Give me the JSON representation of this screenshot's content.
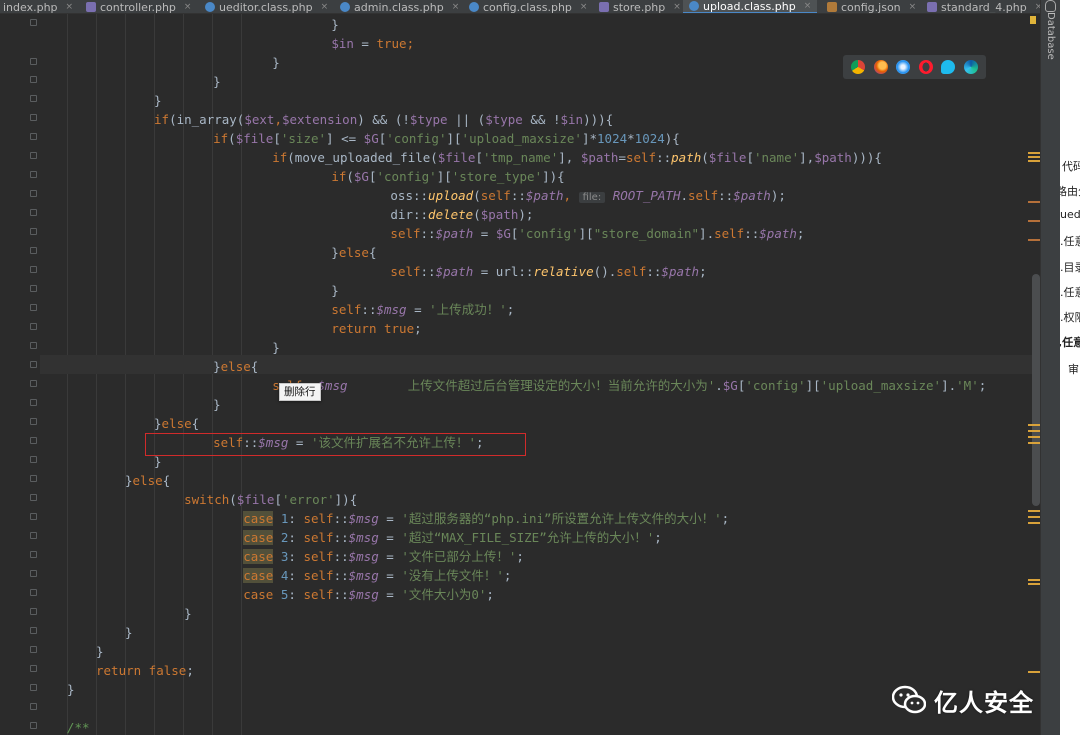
{
  "tabs": [
    {
      "label": "index.php",
      "icon": "php-file-icon"
    },
    {
      "label": "controller.php",
      "icon": "php-file-icon"
    },
    {
      "label": "ueditor.class.php",
      "icon": "php-class-icon"
    },
    {
      "label": "admin.class.php",
      "icon": "php-class-icon"
    },
    {
      "label": "config.class.php",
      "icon": "php-class-icon"
    },
    {
      "label": "store.php",
      "icon": "php-file-icon"
    },
    {
      "label": "upload.class.php",
      "icon": "php-class-icon",
      "active": true
    },
    {
      "label": "config.json",
      "icon": "json-file-icon"
    },
    {
      "label": "standard_4.php",
      "icon": "php-file-icon"
    }
  ],
  "code": [
    [
      [
        "            }",
        ""
      ]
    ],
    [
      [
        "            ",
        ""
      ],
      [
        "$in",
        "var"
      ],
      [
        " = ",
        ""
      ],
      [
        "true",
        "kw"
      ],
      [
        ";",
        "kw"
      ]
    ],
    [
      [
        "        }",
        ""
      ]
    ],
    [
      [
        "    }",
        ""
      ]
    ],
    [
      [
        "}",
        ""
      ]
    ],
    [
      [
        "if",
        "kw"
      ],
      [
        "(in_array(",
        ""
      ],
      [
        "$ext",
        "var"
      ],
      [
        ",",
        "kw"
      ],
      [
        "$extension",
        "var"
      ],
      [
        ") && (!",
        ""
      ],
      [
        "$type",
        "var"
      ],
      [
        " || (",
        ""
      ],
      [
        "$type",
        "var"
      ],
      [
        " && !",
        ""
      ],
      [
        "$in",
        "var"
      ],
      [
        "))){",
        ""
      ]
    ],
    [
      [
        "    ",
        ""
      ],
      [
        "if",
        "kw"
      ],
      [
        "(",
        ""
      ],
      [
        "$file",
        "var"
      ],
      [
        "[",
        ""
      ],
      [
        "'size'",
        "str"
      ],
      [
        "] <= ",
        ""
      ],
      [
        "$G",
        "var"
      ],
      [
        "[",
        ""
      ],
      [
        "'config'",
        "str"
      ],
      [
        "][",
        ""
      ],
      [
        "'upload_maxsize'",
        "str"
      ],
      [
        "]*",
        ""
      ],
      [
        "1024",
        "num"
      ],
      [
        "*",
        ""
      ],
      [
        "1024",
        "num"
      ],
      [
        "){",
        ""
      ]
    ],
    [
      [
        "        ",
        ""
      ],
      [
        "if",
        "kw"
      ],
      [
        "(move_uploaded_file(",
        ""
      ],
      [
        "$file",
        "var"
      ],
      [
        "[",
        ""
      ],
      [
        "'tmp_name'",
        "str"
      ],
      [
        "], ",
        ""
      ],
      [
        "$path",
        "var"
      ],
      [
        "=",
        ""
      ],
      [
        "self",
        "kw"
      ],
      [
        "::",
        ""
      ],
      [
        "path",
        "fn"
      ],
      [
        "(",
        ""
      ],
      [
        "$file",
        "var"
      ],
      [
        "[",
        ""
      ],
      [
        "'name'",
        "str"
      ],
      [
        "],",
        ""
      ],
      [
        "$path",
        "var"
      ],
      [
        "))){",
        ""
      ]
    ],
    [
      [
        "            ",
        ""
      ],
      [
        "if",
        "kw"
      ],
      [
        "(",
        ""
      ],
      [
        "$G",
        "var"
      ],
      [
        "[",
        ""
      ],
      [
        "'config'",
        "str"
      ],
      [
        "][",
        ""
      ],
      [
        "'store_type'",
        "str"
      ],
      [
        "]){",
        ""
      ]
    ],
    [
      [
        "                oss::",
        ""
      ],
      [
        "upload",
        "fn"
      ],
      [
        "(",
        ""
      ],
      [
        "self",
        "kw"
      ],
      [
        "::",
        ""
      ],
      [
        "$path",
        "ivar"
      ],
      [
        ", ",
        "kw"
      ],
      [
        "file:",
        "hint"
      ],
      [
        " ",
        ""
      ],
      [
        "ROOT_PATH",
        "ivar"
      ],
      [
        ".",
        ""
      ],
      [
        "self",
        "kw"
      ],
      [
        "::",
        ""
      ],
      [
        "$path",
        "ivar"
      ],
      [
        ");",
        ""
      ]
    ],
    [
      [
        "                dir::",
        ""
      ],
      [
        "delete",
        "fn"
      ],
      [
        "(",
        ""
      ],
      [
        "$path",
        "var"
      ],
      [
        ");",
        ""
      ]
    ],
    [
      [
        "                ",
        ""
      ],
      [
        "self",
        "kw"
      ],
      [
        "::",
        ""
      ],
      [
        "$path",
        "ivar"
      ],
      [
        " = ",
        ""
      ],
      [
        "$G",
        "var"
      ],
      [
        "[",
        ""
      ],
      [
        "'config'",
        "str"
      ],
      [
        "][",
        ""
      ],
      [
        "\"store_domain\"",
        "str"
      ],
      [
        "].",
        ""
      ],
      [
        "self",
        "kw"
      ],
      [
        "::",
        ""
      ],
      [
        "$path",
        "ivar"
      ],
      [
        ";",
        ""
      ]
    ],
    [
      [
        "            }",
        ""
      ],
      [
        "else",
        "kw"
      ],
      [
        "{",
        ""
      ]
    ],
    [
      [
        "                ",
        ""
      ],
      [
        "self",
        "kw"
      ],
      [
        "::",
        ""
      ],
      [
        "$path",
        "ivar"
      ],
      [
        " = url::",
        ""
      ],
      [
        "relative",
        "fn"
      ],
      [
        "().",
        ""
      ],
      [
        "self",
        "kw"
      ],
      [
        "::",
        ""
      ],
      [
        "$path",
        "ivar"
      ],
      [
        ";",
        ""
      ]
    ],
    [
      [
        "            }",
        ""
      ]
    ],
    [
      [
        "            ",
        ""
      ],
      [
        "self",
        "kw"
      ],
      [
        "::",
        ""
      ],
      [
        "$msg",
        "ivar"
      ],
      [
        " = ",
        ""
      ],
      [
        "'上传成功！'",
        "str"
      ],
      [
        ";",
        ""
      ]
    ],
    [
      [
        "            ",
        ""
      ],
      [
        "return true",
        "kw"
      ],
      [
        ";",
        ""
      ]
    ],
    [
      [
        "        }",
        ""
      ]
    ],
    [
      [
        "    }",
        ""
      ],
      [
        "else",
        "kw"
      ],
      [
        "{",
        ""
      ]
    ],
    [
      [
        "        ",
        ""
      ],
      [
        "self",
        "kw"
      ],
      [
        "::",
        ""
      ],
      [
        "$msg",
        "ivar"
      ],
      [
        "        ",
        ""
      ],
      [
        "上传文件超过后台管理设定的大小！当前允许的大小为'",
        "str"
      ],
      [
        ".",
        ""
      ],
      [
        "$G",
        "var"
      ],
      [
        "[",
        ""
      ],
      [
        "'config'",
        "str"
      ],
      [
        "][",
        ""
      ],
      [
        "'upload_maxsize'",
        "str"
      ],
      [
        "].",
        ""
      ],
      [
        "'M'",
        "str"
      ],
      [
        ";",
        ""
      ]
    ],
    [
      [
        "    }",
        ""
      ]
    ],
    [
      [
        "}",
        ""
      ],
      [
        "else",
        "kw"
      ],
      [
        "{",
        ""
      ]
    ],
    [
      [
        "    ",
        ""
      ],
      [
        "self",
        "kw"
      ],
      [
        "::",
        ""
      ],
      [
        "$msg",
        "ivar"
      ],
      [
        " = ",
        ""
      ],
      [
        "'该文件扩展名不允许上传！'",
        "str"
      ],
      [
        ";",
        ""
      ]
    ],
    [
      [
        "}",
        ""
      ]
    ],
    [
      [
        "}",
        ""
      ],
      [
        "else",
        "kw"
      ],
      [
        "{",
        ""
      ]
    ],
    [
      [
        "    ",
        ""
      ],
      [
        "switch",
        "kw"
      ],
      [
        "(",
        ""
      ],
      [
        "$file",
        "var"
      ],
      [
        "[",
        ""
      ],
      [
        "'error'",
        "str"
      ],
      [
        "]){",
        ""
      ]
    ],
    [
      [
        "        ",
        ""
      ],
      [
        "case",
        "caseh"
      ],
      [
        " ",
        ""
      ],
      [
        "1",
        "num"
      ],
      [
        ": ",
        ""
      ],
      [
        "self",
        "kw"
      ],
      [
        "::",
        ""
      ],
      [
        "$msg",
        "ivar"
      ],
      [
        " = ",
        ""
      ],
      [
        "'超过服务器的“php.ini”所设置允许上传文件的大小！'",
        "str"
      ],
      [
        ";",
        ""
      ]
    ],
    [
      [
        "        ",
        ""
      ],
      [
        "case",
        "caseh"
      ],
      [
        " ",
        ""
      ],
      [
        "2",
        "num"
      ],
      [
        ": ",
        ""
      ],
      [
        "self",
        "kw"
      ],
      [
        "::",
        ""
      ],
      [
        "$msg",
        "ivar"
      ],
      [
        " = ",
        ""
      ],
      [
        "'超过“MAX_FILE_SIZE”允许上传的大小！'",
        "str"
      ],
      [
        ";",
        ""
      ]
    ],
    [
      [
        "        ",
        ""
      ],
      [
        "case",
        "caseh"
      ],
      [
        " ",
        ""
      ],
      [
        "3",
        "num"
      ],
      [
        ": ",
        ""
      ],
      [
        "self",
        "kw"
      ],
      [
        "::",
        ""
      ],
      [
        "$msg",
        "ivar"
      ],
      [
        " = ",
        ""
      ],
      [
        "'文件已部分上传！'",
        "str"
      ],
      [
        ";",
        ""
      ]
    ],
    [
      [
        "        ",
        ""
      ],
      [
        "case",
        "caseh"
      ],
      [
        " ",
        ""
      ],
      [
        "4",
        "num"
      ],
      [
        ": ",
        ""
      ],
      [
        "self",
        "kw"
      ],
      [
        "::",
        ""
      ],
      [
        "$msg",
        "ivar"
      ],
      [
        " = ",
        ""
      ],
      [
        "'没有上传文件！'",
        "str"
      ],
      [
        ";",
        ""
      ]
    ],
    [
      [
        "        ",
        ""
      ],
      [
        "case",
        "kw"
      ],
      [
        " ",
        ""
      ],
      [
        "5",
        "num"
      ],
      [
        ": ",
        ""
      ],
      [
        "self",
        "kw"
      ],
      [
        "::",
        ""
      ],
      [
        "$msg",
        "ivar"
      ],
      [
        " = ",
        ""
      ],
      [
        "'文件大小为0'",
        "str"
      ],
      [
        ";",
        ""
      ]
    ],
    [
      [
        "    }",
        ""
      ]
    ],
    [
      [
        "}",
        ""
      ]
    ],
    [
      [
        "}",
        ""
      ]
    ],
    [
      [
        "return false",
        "kw"
      ],
      [
        ";",
        ""
      ]
    ],
    [
      [
        "}",
        ""
      ]
    ],
    [
      [
        "",
        ""
      ]
    ],
    [
      [
        "/**",
        "cm"
      ]
    ]
  ],
  "tooltip": "删除行",
  "side_panel": {
    "label": "Database"
  },
  "right_pane_fragments": [
    "代码",
    "路由分",
    "uedi",
    ".任意",
    ".目录",
    ".任意",
    ".权限",
    ",任意",
    "审"
  ],
  "watermark": "亿人安全",
  "browser_icons": [
    "chrome-icon",
    "firefox-icon",
    "safari-icon",
    "opera-icon",
    "ie-icon",
    "edge-icon"
  ]
}
